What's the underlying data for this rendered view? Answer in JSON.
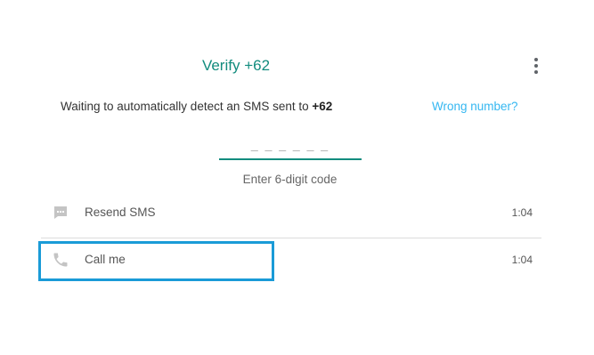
{
  "header": {
    "title": "Verify +62"
  },
  "message": {
    "text": "Waiting to automatically detect an SMS sent to ",
    "number": "+62 ",
    "wrong_number_link": "Wrong number?"
  },
  "code": {
    "placeholder": "_ _ _   _ _ _",
    "hint": "Enter 6-digit code"
  },
  "options": [
    {
      "label": "Resend SMS",
      "time": "1:04",
      "icon": "message-icon"
    },
    {
      "label": "Call me",
      "time": "1:04",
      "icon": "phone-icon"
    }
  ],
  "colors": {
    "accent": "#128c7e",
    "link": "#34b7f1",
    "highlight": "#1a9bd7"
  }
}
